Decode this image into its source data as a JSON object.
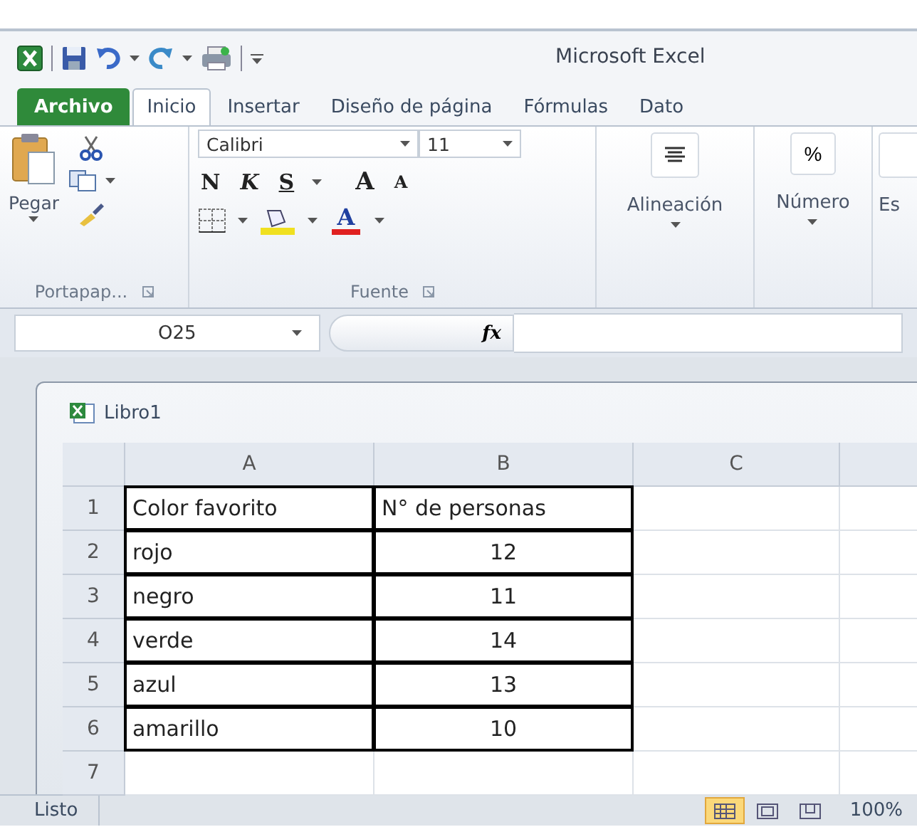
{
  "window": {
    "title": "Microsoft Excel"
  },
  "tabs": [
    {
      "label": "Archivo",
      "kind": "file",
      "selected": false
    },
    {
      "label": "Inicio",
      "kind": "tab",
      "selected": true
    },
    {
      "label": "Insertar",
      "kind": "tab",
      "selected": false
    },
    {
      "label": "Diseño de página",
      "kind": "tab",
      "selected": false
    },
    {
      "label": "Fórmulas",
      "kind": "tab",
      "selected": false
    },
    {
      "label": "Dato",
      "kind": "tab",
      "selected": false
    }
  ],
  "ribbon": {
    "clipboard": {
      "paste": "Pegar",
      "label": "Portapap..."
    },
    "font": {
      "name": "Calibri",
      "size": "11",
      "bold": "N",
      "italic": "K",
      "underline": "S",
      "grow": "A",
      "shrink": "A",
      "color_letter": "A",
      "label": "Fuente"
    },
    "alignment": {
      "label": "Alineación"
    },
    "number": {
      "symbol": "%",
      "label": "Número"
    },
    "cut_group": {
      "label": "Es"
    }
  },
  "formula_bar": {
    "name_box": "O25",
    "fx": "fx"
  },
  "workbook": {
    "title": "Libro1",
    "columns": [
      "A",
      "B",
      "C"
    ],
    "rows": [
      {
        "number": "1",
        "cells": [
          "Color favorito",
          "N° de personas"
        ]
      },
      {
        "number": "2",
        "cells": [
          "rojo",
          "12"
        ]
      },
      {
        "number": "3",
        "cells": [
          "negro",
          "11"
        ]
      },
      {
        "number": "4",
        "cells": [
          "verde",
          "14"
        ]
      },
      {
        "number": "5",
        "cells": [
          "azul",
          "13"
        ]
      },
      {
        "number": "6",
        "cells": [
          "amarillo",
          "10"
        ]
      },
      {
        "number": "7"
      }
    ]
  },
  "status_bar": {
    "text": "Listo",
    "zoom": "100%",
    "views": [
      {
        "kind": "normal",
        "selected": true
      },
      {
        "kind": "layout",
        "selected": false
      },
      {
        "kind": "pagebreak",
        "selected": false
      }
    ]
  }
}
